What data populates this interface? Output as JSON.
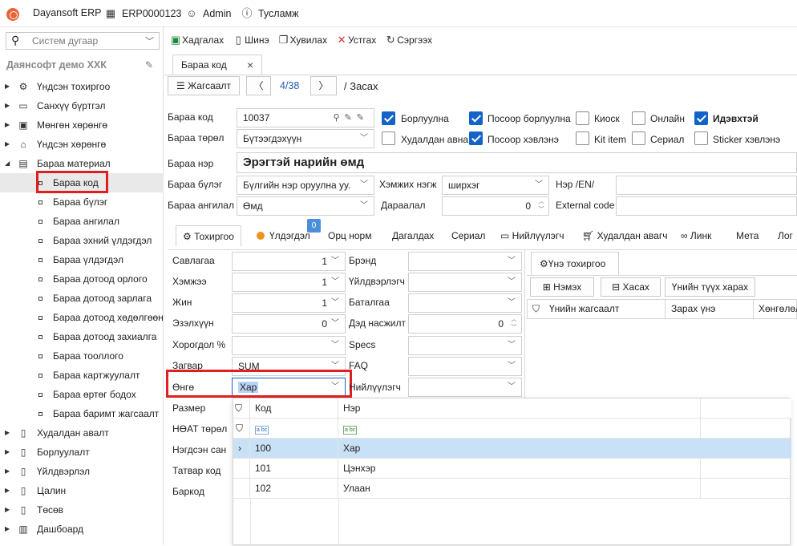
{
  "topbar": {
    "app": "Dayansoft ERP",
    "code": "ERP0000123",
    "user": "Admin",
    "help": "Тусламж"
  },
  "sidebar": {
    "search_placeholder": "Систем дугаар",
    "company": "Даянсофт демо ХХК",
    "items": [
      {
        "label": "Үндсэн тохиргоо"
      },
      {
        "label": "Санхүү бүртгэл"
      },
      {
        "label": "Мөнгөн хөрөнгө"
      },
      {
        "label": "Үндсэн хөрөнгө"
      },
      {
        "label": "Бараа материал"
      }
    ],
    "children": [
      {
        "label": "Бараа код"
      },
      {
        "label": "Бараа бүлэг"
      },
      {
        "label": "Бараа ангилал"
      },
      {
        "label": "Бараа эхний үлдэгдэл"
      },
      {
        "label": "Бараа үлдэгдэл"
      },
      {
        "label": "Бараа дотоод орлого"
      },
      {
        "label": "Бараа дотоод зарлага"
      },
      {
        "label": "Бараа дотоод хөдөлгөөн"
      },
      {
        "label": "Бараа дотоод захиалга"
      },
      {
        "label": "Бараа тооллого"
      },
      {
        "label": "Бараа картжуулалт"
      },
      {
        "label": "Бараа өртөг бодох"
      },
      {
        "label": "Бараа баримт жагсаалт"
      }
    ],
    "more": [
      {
        "label": "Худалдан авалт"
      },
      {
        "label": "Борлуулалт"
      },
      {
        "label": "Үйлдвэрлэл"
      },
      {
        "label": "Цалин"
      },
      {
        "label": "Төсөв"
      },
      {
        "label": "Дашбоард"
      }
    ]
  },
  "toolbar": {
    "save": "Хадгалах",
    "new": "Шинэ",
    "copy": "Хувилах",
    "delete": "Устгах",
    "refresh": "Сэргээх"
  },
  "tab": {
    "title": "Бараа код"
  },
  "nav": {
    "list": "Жагсаалт",
    "count": "4/38",
    "crumb": "/ Засах"
  },
  "form": {
    "code_label": "Бараа код",
    "code": "10037",
    "type_label": "Бараа төрөл",
    "type": "Бүтээгдэхүүн",
    "name_label": "Бараа нэр",
    "name": "Эрэгтэй нарийн өмд",
    "group_label": "Бараа бүлэг",
    "group": "Бүлгийн нэр оруулна уу.",
    "unit_label": "Хэмжих нэгж",
    "unit": "ширхэг",
    "name_en_label": "Нэр /EN/",
    "category_label": "Бараа ангилал",
    "category": "Өмд",
    "order_label": "Дараалал",
    "order": "0",
    "external_label": "External code"
  },
  "checks": [
    {
      "label": "Борлуулна",
      "on": true
    },
    {
      "label": "Посоор борлуулна",
      "on": true
    },
    {
      "label": "Киоск",
      "on": false
    },
    {
      "label": "Онлайн",
      "on": false
    },
    {
      "label": "Идэвхтэй",
      "on": true
    },
    {
      "label": "Худалдан авна",
      "on": false
    },
    {
      "label": "Посоор хэвлэнэ",
      "on": true
    },
    {
      "label": "Kit item",
      "on": false
    },
    {
      "label": "Сериал",
      "on": false
    },
    {
      "label": "Sticker хэвлэнэ",
      "on": false
    }
  ],
  "subtabs": {
    "settings": "Тохиргоо",
    "balance": "Үлдэгдэл",
    "badge": "0",
    "ingredient": "Орц норм",
    "attached": "Дагалдах",
    "serial": "Сериал",
    "supplier": "Нийлүүлэгч",
    "buyer": "Худалдан авагч",
    "link": "Линк",
    "meta": "Мета",
    "log": "Лог"
  },
  "settings": {
    "volume_label": "Савлагаа",
    "volume": "1",
    "measure_label": "Хэмжээ",
    "measure": "1",
    "weight_label": "Жин",
    "weight": "1",
    "capacity_label": "Эзэлхүүн",
    "capacity": "0",
    "discount_label": "Хорогдол %",
    "formula_label": "Загвар",
    "formula": "SUM",
    "color_label": "Өнгө",
    "color": "Хар",
    "size_label": "Размер",
    "vat_label": "НӨАТ төрөл",
    "warehouse_label": "Нэгдсэн сан",
    "tax_label": "Татвар код",
    "barcode_label": "Баркод",
    "brand_label": "Брэнд",
    "maker_label": "Үйлдвэрлэгч",
    "warranty_label": "Баталгаа",
    "next_label": "Дэд насжилт",
    "next": "0",
    "specs_label": "Specs",
    "faq_label": "FAQ",
    "supplier_label": "Нийлүүлэгч"
  },
  "price": {
    "tab": "Үнэ тохиргоо",
    "add": "Нэмэх",
    "remove": "Хасах",
    "history": "Үнийн түүх харах",
    "col1": "Үнийн жагсаалт",
    "col2": "Зарах үнэ",
    "col3": "Хөнгөлөл"
  },
  "dropdown": {
    "col_code": "Код",
    "col_name": "Нэр",
    "rows": [
      {
        "code": "100",
        "name": "Хар"
      },
      {
        "code": "101",
        "name": "Цэнхэр"
      },
      {
        "code": "102",
        "name": "Улаан"
      }
    ]
  }
}
